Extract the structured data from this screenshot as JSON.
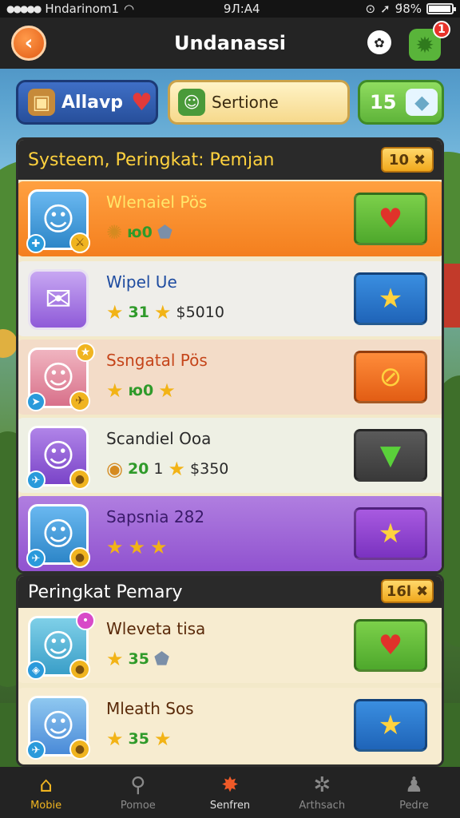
{
  "status_bar": {
    "carrier": "Hndarinom1",
    "time": "9Л:А4",
    "battery": "9̈8%",
    "battery_level": 0.98
  },
  "header": {
    "title": "Undanassi",
    "notification_count": "1",
    "icons": [
      "back-arrow-icon",
      "chat-icon",
      "gear-icon"
    ]
  },
  "tabs": [
    {
      "label": "Allavp",
      "icon": "crate-icon"
    },
    {
      "label": "Sertione",
      "icon": "character-icon"
    },
    {
      "label": "15",
      "icon": "gem-icon"
    }
  ],
  "section1": {
    "title": "Systeem, Peringkat: Pemjan",
    "badge": "10",
    "rows": [
      {
        "name": "Wlenaiel Pös",
        "stat1": "ю0",
        "stat2": "",
        "money": "",
        "action_icon": "heart-icon"
      },
      {
        "name": "Wipel Ue",
        "stat1": "31",
        "stat2": "",
        "money": "$5010",
        "action_icon": "star-icon"
      },
      {
        "name": "Ssngatal Pös",
        "stat1": "ю0",
        "stat2": "",
        "money": "",
        "action_icon": "coin-slash-icon"
      },
      {
        "name": "Scandiel Ooa",
        "stat1": "20",
        "stat2": "1",
        "money": "$350",
        "action_icon": "down-arrow-icon"
      },
      {
        "name": "Sapsnia 282",
        "stat1": "",
        "stat2": "",
        "money": "",
        "action_icon": "star-icon"
      }
    ]
  },
  "section2": {
    "title": "Peringkat  Pemary",
    "badge": "16l",
    "rows": [
      {
        "name": "Wleveta tisa",
        "stat1": "35",
        "action_icon": "heart-icon"
      },
      {
        "name": "Mleath Sos",
        "stat1": "35",
        "action_icon": "star-icon"
      }
    ]
  },
  "bottom_nav": [
    {
      "label": "Mobie",
      "icon": "home-icon"
    },
    {
      "label": "Pomoe",
      "icon": "search-icon"
    },
    {
      "label": "Senfren",
      "icon": "fire-icon"
    },
    {
      "label": "Arthsach",
      "icon": "film-icon"
    },
    {
      "label": "Pedre",
      "icon": "profile-icon"
    }
  ],
  "colors": {
    "accent_orange": "#f47f1e",
    "accent_green": "#4ea82c",
    "accent_blue": "#1f64b8",
    "accent_purple": "#9052cf",
    "panel_header": "#2a2a2a",
    "gold": "#f0b420"
  }
}
